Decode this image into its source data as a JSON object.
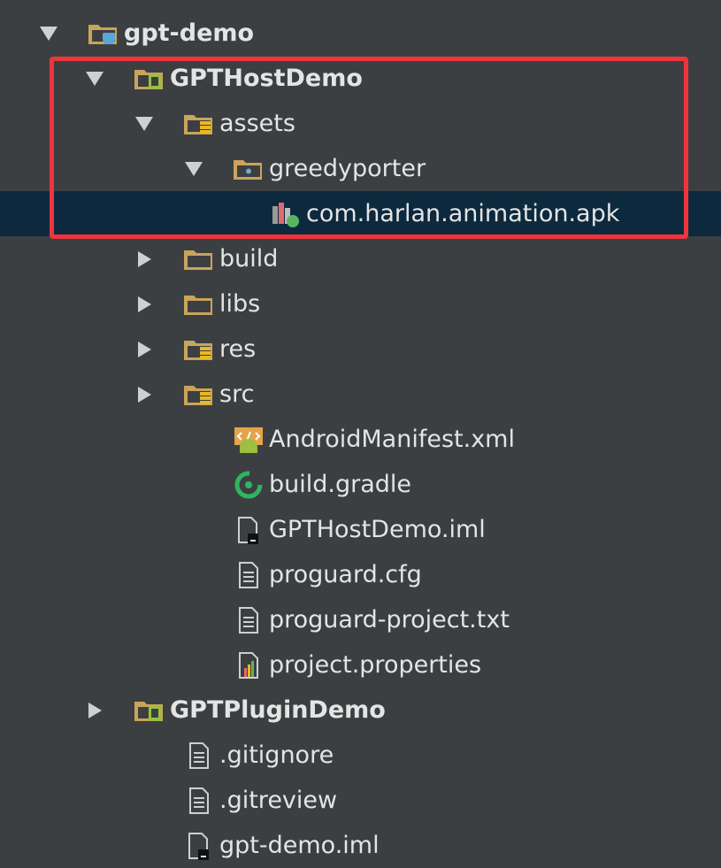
{
  "tree": [
    {
      "label": "gpt-demo",
      "depth": 0,
      "arrow": "down",
      "icon": "module-folder-icon",
      "bold": true
    },
    {
      "label": "GPTHostDemo",
      "depth": 1,
      "arrow": "down",
      "icon": "android-module-folder-icon",
      "bold": true
    },
    {
      "label": "assets",
      "depth": 2,
      "arrow": "down",
      "icon": "resource-folder-icon",
      "bold": false
    },
    {
      "label": "greedyporter",
      "depth": 3,
      "arrow": "down",
      "icon": "package-folder-icon",
      "bold": false
    },
    {
      "label": "com.harlan.animation.apk",
      "depth": 4,
      "arrow": "none",
      "icon": "apk-file-icon",
      "bold": false,
      "selected": true
    },
    {
      "label": "build",
      "depth": 2,
      "arrow": "right",
      "icon": "folder-icon",
      "bold": false
    },
    {
      "label": "libs",
      "depth": 2,
      "arrow": "right",
      "icon": "folder-icon",
      "bold": false
    },
    {
      "label": "res",
      "depth": 2,
      "arrow": "right",
      "icon": "resource-folder-icon",
      "bold": false
    },
    {
      "label": "src",
      "depth": 2,
      "arrow": "right",
      "icon": "resource-folder-icon",
      "bold": false
    },
    {
      "label": "AndroidManifest.xml",
      "depth": 3,
      "arrow": "none",
      "icon": "android-manifest-icon",
      "bold": false
    },
    {
      "label": "build.gradle",
      "depth": 3,
      "arrow": "none",
      "icon": "gradle-icon",
      "bold": false
    },
    {
      "label": "GPTHostDemo.iml",
      "depth": 3,
      "arrow": "none",
      "icon": "iml-file-icon",
      "bold": false
    },
    {
      "label": "proguard.cfg",
      "depth": 3,
      "arrow": "none",
      "icon": "text-file-icon",
      "bold": false
    },
    {
      "label": "proguard-project.txt",
      "depth": 3,
      "arrow": "none",
      "icon": "text-file-icon",
      "bold": false
    },
    {
      "label": "project.properties",
      "depth": 3,
      "arrow": "none",
      "icon": "properties-file-icon",
      "bold": false
    },
    {
      "label": "GPTPluginDemo",
      "depth": 1,
      "arrow": "right",
      "icon": "android-module-folder-icon",
      "bold": true
    },
    {
      "label": ".gitignore",
      "depth": 2,
      "arrow": "none",
      "icon": "text-file-icon",
      "bold": false
    },
    {
      "label": ".gitreview",
      "depth": 2,
      "arrow": "none",
      "icon": "text-file-icon",
      "bold": false
    },
    {
      "label": "gpt-demo.iml",
      "depth": 2,
      "arrow": "none",
      "icon": "iml-file-icon",
      "bold": false
    }
  ],
  "colors": {
    "background": "#3c3f41",
    "selection": "#0d293e",
    "highlight": "#f0343c",
    "folder": "#c9a45c"
  }
}
